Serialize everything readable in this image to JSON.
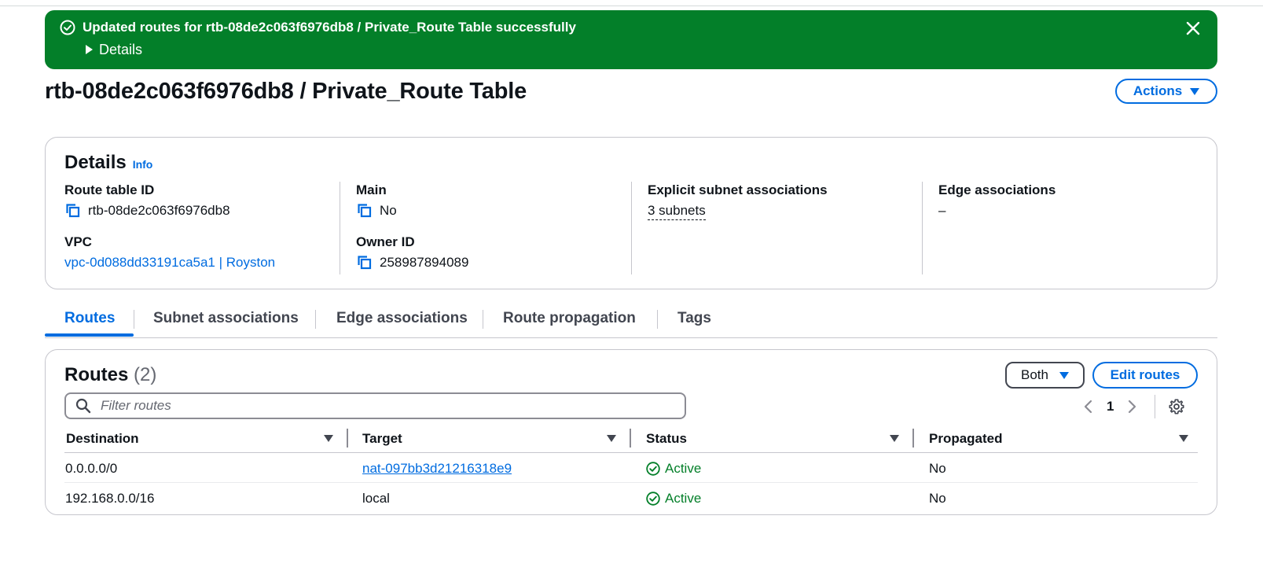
{
  "flash": {
    "message": "Updated routes for rtb-08de2c063f6976db8 / Private_Route Table successfully",
    "details_label": "Details"
  },
  "page": {
    "title": "rtb-08de2c063f6976db8 / Private_Route Table",
    "actions_label": "Actions"
  },
  "details": {
    "title": "Details",
    "info_label": "Info",
    "route_table_id_label": "Route table ID",
    "route_table_id": "rtb-08de2c063f6976db8",
    "main_label": "Main",
    "main_value": "No",
    "explicit_label": "Explicit subnet associations",
    "explicit_value": "3 subnets",
    "edge_label": "Edge associations",
    "edge_value": "–",
    "vpc_label": "VPC",
    "vpc_value": "vpc-0d088dd33191ca5a1 | Royston",
    "owner_label": "Owner ID",
    "owner_value": "258987894089"
  },
  "tabs": [
    {
      "label": "Routes",
      "active": true
    },
    {
      "label": "Subnet associations",
      "active": false
    },
    {
      "label": "Edge associations",
      "active": false
    },
    {
      "label": "Route propagation",
      "active": false
    },
    {
      "label": "Tags",
      "active": false
    }
  ],
  "routes": {
    "title": "Routes",
    "count": "(2)",
    "filter_label": "Both",
    "edit_label": "Edit routes",
    "search_placeholder": "Filter routes",
    "page_number": "1",
    "columns": [
      "Destination",
      "Target",
      "Status",
      "Propagated"
    ],
    "rows": [
      {
        "destination": "0.0.0.0/0",
        "target": "nat-097bb3d21216318e9",
        "target_is_link": true,
        "status": "Active",
        "propagated": "No"
      },
      {
        "destination": "192.168.0.0/16",
        "target": "local",
        "target_is_link": false,
        "status": "Active",
        "propagated": "No"
      }
    ]
  },
  "colors": {
    "success": "#037f29",
    "link": "#006ce0",
    "border": "#c6c6cd"
  },
  "icons": [
    "success-check-icon",
    "close-icon",
    "copy-icon",
    "search-icon",
    "chevron-left-icon",
    "chevron-right-icon",
    "settings-gear-icon",
    "sort-caret-icon",
    "status-check-icon"
  ]
}
